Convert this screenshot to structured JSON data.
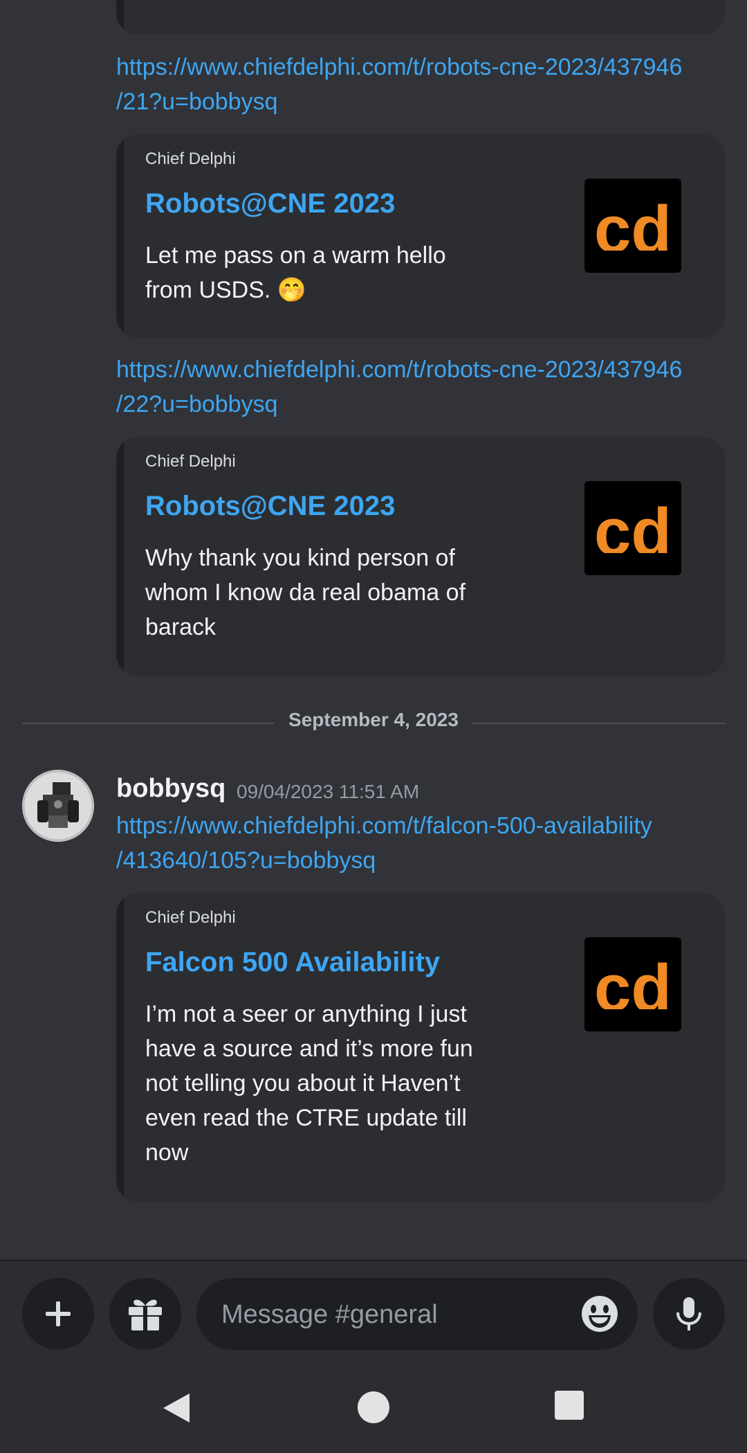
{
  "messages": {
    "link1": {
      "line1": "https://www.chiefdelphi.com/t/robots-cne-2023/437946",
      "line2": "/21?u=bobbysq"
    },
    "embed1": {
      "provider": "Chief Delphi",
      "title": "Robots@CNE 2023",
      "desc_lines": [
        "Let me pass on a warm hello",
        "from USDS. 🤭"
      ]
    },
    "link2": {
      "line1": "https://www.chiefdelphi.com/t/robots-cne-2023/437946",
      "line2": "/22?u=bobbysq"
    },
    "embed2": {
      "provider": "Chief Delphi",
      "title": "Robots@CNE 2023",
      "desc_lines": [
        "Why thank you kind person of",
        "whom I know   da real obama of",
        "barack"
      ]
    },
    "date_divider": "September 4, 2023",
    "post": {
      "username": "bobbysq",
      "timestamp": "09/04/2023 11:51 AM",
      "link": {
        "line1": "https://www.chiefdelphi.com/t/falcon-500-availability",
        "line2": "/413640/105?u=bobbysq"
      },
      "embed": {
        "provider": "Chief Delphi",
        "title": "Falcon 500 Availability",
        "desc_lines": [
          "I’m not a seer or anything  I just",
          "have a source and it’s more fun",
          "not telling you about it  Haven’t",
          "even read the CTRE update till",
          "now"
        ]
      }
    }
  },
  "logo": {
    "text": "cd",
    "color": "#f08a24"
  },
  "composer": {
    "placeholder": "Message #general",
    "icons": [
      "plus-icon",
      "gift-icon",
      "emoji-icon",
      "microphone-icon"
    ]
  },
  "navbar": {
    "icons": [
      "back-icon",
      "home-icon",
      "recents-icon"
    ]
  },
  "colors": {
    "background": "#313338",
    "embed_bg": "#2b2d31",
    "link": "#3ea6f2",
    "accent_orange": "#f08a24"
  }
}
